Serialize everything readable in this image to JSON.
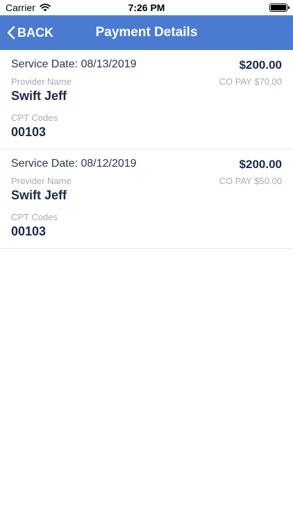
{
  "status_bar": {
    "carrier": "Carrier",
    "time": "7:26 PM",
    "icons": [
      "wifi-icon",
      "battery-icon"
    ]
  },
  "nav": {
    "back_label": "BACK",
    "title": "Payment Details",
    "accent_color": "#4a7bd0"
  },
  "payments": [
    {
      "service_date": "Service Date: 08/13/2019",
      "amount": "$200.00",
      "provider_label": "Provider Name",
      "copay": "CO PAY $70.00",
      "provider_name": "Swift Jeff",
      "cpt_label": "CPT Codes",
      "cpt_code": "00103"
    },
    {
      "service_date": "Service Date: 08/12/2019",
      "amount": "$200.00",
      "provider_label": "Provider Name",
      "copay": "CO PAY $50.00",
      "provider_name": "Swift Jeff",
      "cpt_label": "CPT Codes",
      "cpt_code": "00103"
    }
  ]
}
